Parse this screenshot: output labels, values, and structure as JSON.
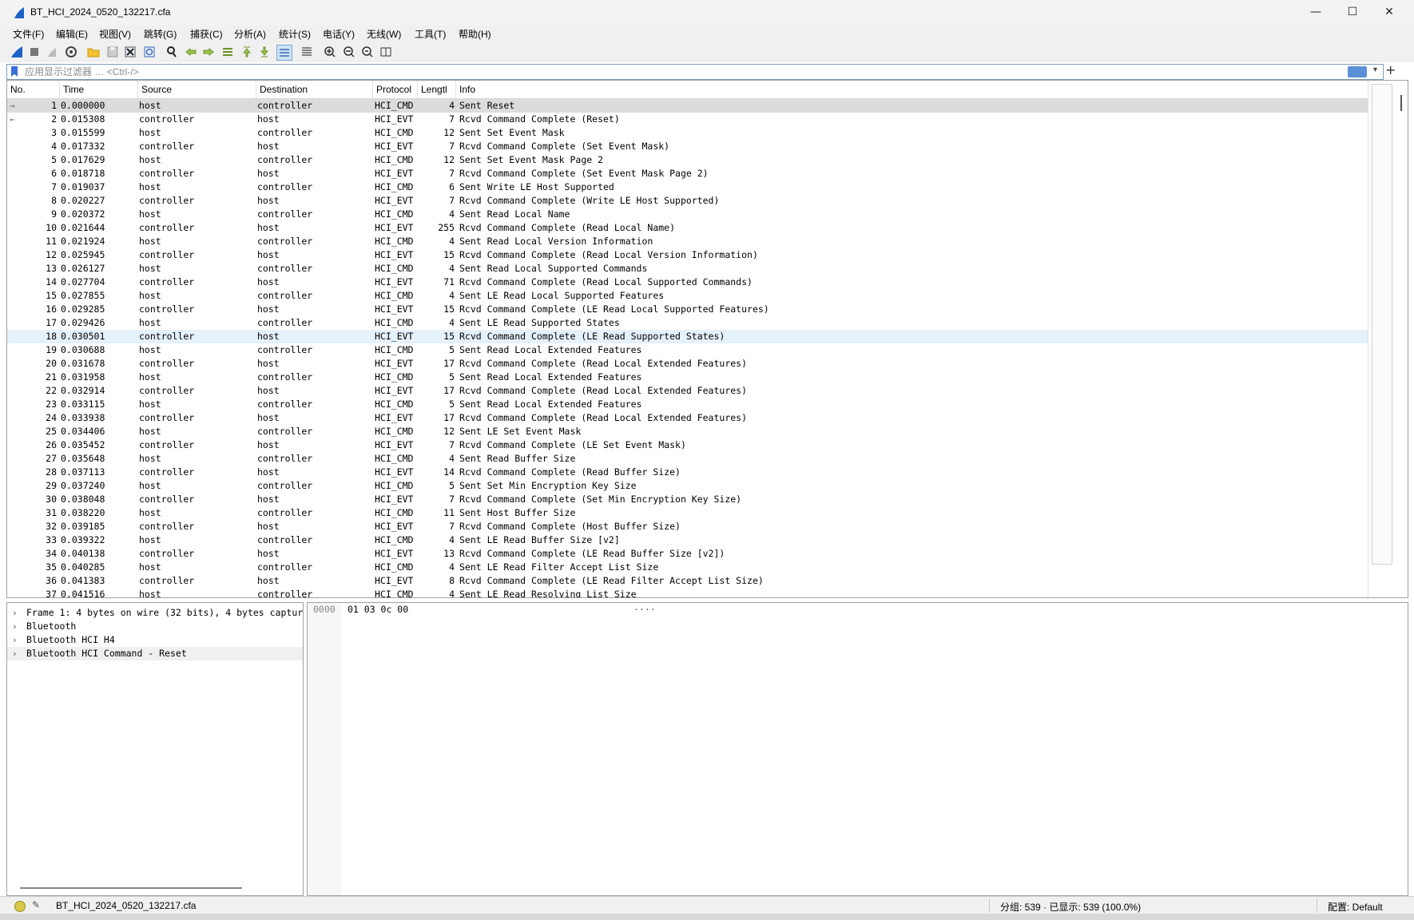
{
  "window": {
    "title": "BT_HCI_2024_0520_132217.cfa",
    "minimize": "—",
    "maximize": "☐",
    "close": "✕"
  },
  "menu": [
    "文件(F)",
    "编辑(E)",
    "视图(V)",
    "跳转(G)",
    "捕获(C)",
    "分析(A)",
    "统计(S)",
    "电话(Y)",
    "无线(W)",
    "工具(T)",
    "帮助(H)"
  ],
  "toolbar": {
    "icons": [
      "shark-fin-start-icon",
      "stop-icon",
      "restart-icon",
      "capture-options-icon",
      "open-file-icon",
      "save-file-icon",
      "close-file-icon",
      "reload-icon",
      "find-packet-icon",
      "go-back-icon",
      "go-forward-icon",
      "go-to-packet-icon",
      "go-first-icon",
      "go-last-icon",
      "auto-scroll-icon",
      "colorize-icon",
      "zoom-in-icon",
      "zoom-out-icon",
      "zoom-normal-icon",
      "resize-columns-icon"
    ]
  },
  "filter": {
    "placeholder": "应用显示过滤器 … <Ctrl-/>",
    "value": "",
    "add": "+"
  },
  "columns": [
    "No.",
    "Time",
    "Source",
    "Destination",
    "Protocol",
    "Lengtl",
    "Info"
  ],
  "packets": [
    {
      "no": "1",
      "time": "0.000000",
      "src": "host",
      "dst": "controller",
      "proto": "HCI_CMD",
      "len": "4",
      "info": "Sent Reset",
      "dir": "→"
    },
    {
      "no": "2",
      "time": "0.015308",
      "src": "controller",
      "dst": "host",
      "proto": "HCI_EVT",
      "len": "7",
      "info": "Rcvd Command Complete (Reset)",
      "dir": "←"
    },
    {
      "no": "3",
      "time": "0.015599",
      "src": "host",
      "dst": "controller",
      "proto": "HCI_CMD",
      "len": "12",
      "info": "Sent Set Event Mask",
      "dir": ""
    },
    {
      "no": "4",
      "time": "0.017332",
      "src": "controller",
      "dst": "host",
      "proto": "HCI_EVT",
      "len": "7",
      "info": "Rcvd Command Complete (Set Event Mask)",
      "dir": ""
    },
    {
      "no": "5",
      "time": "0.017629",
      "src": "host",
      "dst": "controller",
      "proto": "HCI_CMD",
      "len": "12",
      "info": "Sent Set Event Mask Page 2",
      "dir": ""
    },
    {
      "no": "6",
      "time": "0.018718",
      "src": "controller",
      "dst": "host",
      "proto": "HCI_EVT",
      "len": "7",
      "info": "Rcvd Command Complete (Set Event Mask Page 2)",
      "dir": ""
    },
    {
      "no": "7",
      "time": "0.019037",
      "src": "host",
      "dst": "controller",
      "proto": "HCI_CMD",
      "len": "6",
      "info": "Sent Write LE Host Supported",
      "dir": ""
    },
    {
      "no": "8",
      "time": "0.020227",
      "src": "controller",
      "dst": "host",
      "proto": "HCI_EVT",
      "len": "7",
      "info": "Rcvd Command Complete (Write LE Host Supported)",
      "dir": ""
    },
    {
      "no": "9",
      "time": "0.020372",
      "src": "host",
      "dst": "controller",
      "proto": "HCI_CMD",
      "len": "4",
      "info": "Sent Read Local Name",
      "dir": ""
    },
    {
      "no": "10",
      "time": "0.021644",
      "src": "controller",
      "dst": "host",
      "proto": "HCI_EVT",
      "len": "255",
      "info": "Rcvd Command Complete (Read Local Name)",
      "dir": ""
    },
    {
      "no": "11",
      "time": "0.021924",
      "src": "host",
      "dst": "controller",
      "proto": "HCI_CMD",
      "len": "4",
      "info": "Sent Read Local Version Information",
      "dir": ""
    },
    {
      "no": "12",
      "time": "0.025945",
      "src": "controller",
      "dst": "host",
      "proto": "HCI_EVT",
      "len": "15",
      "info": "Rcvd Command Complete (Read Local Version Information)",
      "dir": ""
    },
    {
      "no": "13",
      "time": "0.026127",
      "src": "host",
      "dst": "controller",
      "proto": "HCI_CMD",
      "len": "4",
      "info": "Sent Read Local Supported Commands",
      "dir": ""
    },
    {
      "no": "14",
      "time": "0.027704",
      "src": "controller",
      "dst": "host",
      "proto": "HCI_EVT",
      "len": "71",
      "info": "Rcvd Command Complete (Read Local Supported Commands)",
      "dir": ""
    },
    {
      "no": "15",
      "time": "0.027855",
      "src": "host",
      "dst": "controller",
      "proto": "HCI_CMD",
      "len": "4",
      "info": "Sent LE Read Local Supported Features",
      "dir": ""
    },
    {
      "no": "16",
      "time": "0.029285",
      "src": "controller",
      "dst": "host",
      "proto": "HCI_EVT",
      "len": "15",
      "info": "Rcvd Command Complete (LE Read Local Supported Features)",
      "dir": ""
    },
    {
      "no": "17",
      "time": "0.029426",
      "src": "host",
      "dst": "controller",
      "proto": "HCI_CMD",
      "len": "4",
      "info": "Sent LE Read Supported States",
      "dir": ""
    },
    {
      "no": "18",
      "time": "0.030501",
      "src": "controller",
      "dst": "host",
      "proto": "HCI_EVT",
      "len": "15",
      "info": "Rcvd Command Complete (LE Read Supported States)",
      "dir": ""
    },
    {
      "no": "19",
      "time": "0.030688",
      "src": "host",
      "dst": "controller",
      "proto": "HCI_CMD",
      "len": "5",
      "info": "Sent Read Local Extended Features",
      "dir": ""
    },
    {
      "no": "20",
      "time": "0.031678",
      "src": "controller",
      "dst": "host",
      "proto": "HCI_EVT",
      "len": "17",
      "info": "Rcvd Command Complete (Read Local Extended Features)",
      "dir": ""
    },
    {
      "no": "21",
      "time": "0.031958",
      "src": "host",
      "dst": "controller",
      "proto": "HCI_CMD",
      "len": "5",
      "info": "Sent Read Local Extended Features",
      "dir": ""
    },
    {
      "no": "22",
      "time": "0.032914",
      "src": "controller",
      "dst": "host",
      "proto": "HCI_EVT",
      "len": "17",
      "info": "Rcvd Command Complete (Read Local Extended Features)",
      "dir": ""
    },
    {
      "no": "23",
      "time": "0.033115",
      "src": "host",
      "dst": "controller",
      "proto": "HCI_CMD",
      "len": "5",
      "info": "Sent Read Local Extended Features",
      "dir": ""
    },
    {
      "no": "24",
      "time": "0.033938",
      "src": "controller",
      "dst": "host",
      "proto": "HCI_EVT",
      "len": "17",
      "info": "Rcvd Command Complete (Read Local Extended Features)",
      "dir": ""
    },
    {
      "no": "25",
      "time": "0.034406",
      "src": "host",
      "dst": "controller",
      "proto": "HCI_CMD",
      "len": "12",
      "info": "Sent LE Set Event Mask",
      "dir": ""
    },
    {
      "no": "26",
      "time": "0.035452",
      "src": "controller",
      "dst": "host",
      "proto": "HCI_EVT",
      "len": "7",
      "info": "Rcvd Command Complete (LE Set Event Mask)",
      "dir": ""
    },
    {
      "no": "27",
      "time": "0.035648",
      "src": "host",
      "dst": "controller",
      "proto": "HCI_CMD",
      "len": "4",
      "info": "Sent Read Buffer Size",
      "dir": ""
    },
    {
      "no": "28",
      "time": "0.037113",
      "src": "controller",
      "dst": "host",
      "proto": "HCI_EVT",
      "len": "14",
      "info": "Rcvd Command Complete (Read Buffer Size)",
      "dir": ""
    },
    {
      "no": "29",
      "time": "0.037240",
      "src": "host",
      "dst": "controller",
      "proto": "HCI_CMD",
      "len": "5",
      "info": "Sent Set Min Encryption Key Size",
      "dir": ""
    },
    {
      "no": "30",
      "time": "0.038048",
      "src": "controller",
      "dst": "host",
      "proto": "HCI_EVT",
      "len": "7",
      "info": "Rcvd Command Complete (Set Min Encryption Key Size)",
      "dir": ""
    },
    {
      "no": "31",
      "time": "0.038220",
      "src": "host",
      "dst": "controller",
      "proto": "HCI_CMD",
      "len": "11",
      "info": "Sent Host Buffer Size",
      "dir": ""
    },
    {
      "no": "32",
      "time": "0.039185",
      "src": "controller",
      "dst": "host",
      "proto": "HCI_EVT",
      "len": "7",
      "info": "Rcvd Command Complete (Host Buffer Size)",
      "dir": ""
    },
    {
      "no": "33",
      "time": "0.039322",
      "src": "host",
      "dst": "controller",
      "proto": "HCI_CMD",
      "len": "4",
      "info": "Sent LE Read Buffer Size [v2]",
      "dir": ""
    },
    {
      "no": "34",
      "time": "0.040138",
      "src": "controller",
      "dst": "host",
      "proto": "HCI_EVT",
      "len": "13",
      "info": "Rcvd Command Complete (LE Read Buffer Size [v2])",
      "dir": ""
    },
    {
      "no": "35",
      "time": "0.040285",
      "src": "host",
      "dst": "controller",
      "proto": "HCI_CMD",
      "len": "4",
      "info": "Sent LE Read Filter Accept List Size",
      "dir": ""
    },
    {
      "no": "36",
      "time": "0.041383",
      "src": "controller",
      "dst": "host",
      "proto": "HCI_EVT",
      "len": "8",
      "info": "Rcvd Command Complete (LE Read Filter Accept List Size)",
      "dir": ""
    },
    {
      "no": "37",
      "time": "0.041516",
      "src": "host",
      "dst": "controller",
      "proto": "HCI_CMD",
      "len": "4",
      "info": "Sent LE Read Resolving List Size",
      "dir": ""
    }
  ],
  "selected_row": 0,
  "hover_row": 17,
  "details": [
    {
      "label": "Frame 1: 4 bytes on wire (32 bits), 4 bytes captur",
      "expander": "›"
    },
    {
      "label": "Bluetooth",
      "expander": "›"
    },
    {
      "label": "Bluetooth HCI H4",
      "expander": "›"
    },
    {
      "label": "Bluetooth HCI Command - Reset",
      "expander": "›"
    }
  ],
  "bytes": {
    "offset": "0000",
    "hex": "01 03 0c 00",
    "ascii": "····"
  },
  "status": {
    "file": "BT_HCI_2024_0520_132217.cfa",
    "count": "分组: 539 · 已显示: 539 (100.0%)",
    "profile": "配置: Default"
  },
  "colors": {
    "selected": "#dcdcdc",
    "hover": "#e5f1fb",
    "accent": "#3b6fd8"
  }
}
